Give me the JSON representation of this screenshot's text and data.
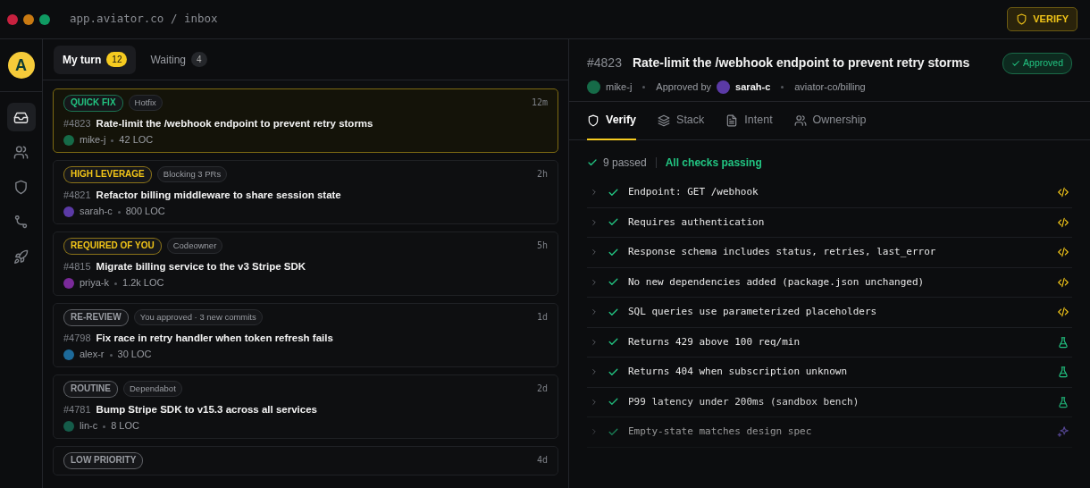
{
  "window": {
    "address": "app.aviator.co / inbox",
    "verify_button": "VERIFY"
  },
  "sidebar": {
    "logo": "A",
    "items": [
      {
        "selected": true
      },
      {
        "selected": false
      },
      {
        "selected": false
      },
      {
        "selected": false
      },
      {
        "selected": false
      }
    ]
  },
  "inbox_tabs": [
    {
      "label": "My turn",
      "count": "12",
      "selected": true
    },
    {
      "label": "Waiting",
      "count": "4",
      "selected": false
    }
  ],
  "pull_requests": [
    {
      "tag": {
        "text": "QUICK FIX",
        "color": "#22c582"
      },
      "note": "Hotfix",
      "time": "12m",
      "number": "#4823",
      "title": "Rate-limit the /webhook endpoint to prevent retry storms",
      "author": {
        "name": "mike-j",
        "color": "#166b48"
      },
      "size": "42 LOC",
      "selected": true
    },
    {
      "tag": {
        "text": "HIGH LEVERAGE",
        "color": "#f2c518"
      },
      "note": "Blocking 3 PRs",
      "time": "2h",
      "number": "#4821",
      "title": "Refactor billing middleware to share session state",
      "author": {
        "name": "sarah-c",
        "color": "#5b3aa6"
      },
      "size": "800 LOC",
      "selected": false
    },
    {
      "tag": {
        "text": "REQUIRED OF YOU",
        "color": "#f2c518"
      },
      "note": "Codeowner",
      "time": "5h",
      "number": "#4815",
      "title": "Migrate billing service to the v3 Stripe SDK",
      "author": {
        "name": "priya-k",
        "color": "#7a2a9a"
      },
      "size": "1.2k LOC",
      "selected": false
    },
    {
      "tag": {
        "text": "RE-REVIEW",
        "color": "#9a9da3"
      },
      "note": "You approved · 3 new commits",
      "time": "1d",
      "number": "#4798",
      "title": "Fix race in retry handler when token refresh fails",
      "author": {
        "name": "alex-r",
        "color": "#1d6a9a"
      },
      "size": "30 LOC",
      "selected": false
    },
    {
      "tag": {
        "text": "ROUTINE",
        "color": "#9a9da3"
      },
      "note": "Dependabot",
      "time": "2d",
      "number": "#4781",
      "title": "Bump Stripe SDK to v15.3 across all services",
      "author": {
        "name": "lin-c",
        "color": "#155c4a"
      },
      "size": "8 LOC",
      "selected": false
    },
    {
      "tag": {
        "text": "LOW PRIORITY",
        "color": "#9a9da3"
      },
      "time": "4d",
      "selected": false
    }
  ],
  "detail": {
    "number": "#4823",
    "title": "Rate-limit the /webhook endpoint to prevent retry storms",
    "status": "Approved",
    "author": {
      "name": "mike-j",
      "color": "#166b48"
    },
    "approved_label": "Approved by",
    "approver": {
      "name": "sarah-c",
      "color": "#5b3aa6"
    },
    "repo": "aviator-co/billing",
    "tabs": [
      {
        "label": "Verify",
        "selected": true
      },
      {
        "label": "Stack",
        "selected": false
      },
      {
        "label": "Intent",
        "selected": false
      },
      {
        "label": "Ownership",
        "selected": false
      }
    ],
    "summary": {
      "passed": "9 passed",
      "status": "All checks passing"
    },
    "checks": [
      {
        "text": "Endpoint: GET /webhook",
        "kind": "code"
      },
      {
        "text": "Requires authentication",
        "kind": "code"
      },
      {
        "text": "Response schema includes status, retries, last_error",
        "kind": "code"
      },
      {
        "text": "No new dependencies added (package.json unchanged)",
        "kind": "code"
      },
      {
        "text": "SQL queries use parameterized placeholders",
        "kind": "code"
      },
      {
        "text": "Returns 429 above 100 req/min",
        "kind": "test"
      },
      {
        "text": "Returns 404 when subscription unknown",
        "kind": "test"
      },
      {
        "text": "P99 latency under 200ms (sandbox bench)",
        "kind": "test"
      },
      {
        "text": "Empty-state matches design spec",
        "kind": "visual"
      }
    ]
  }
}
